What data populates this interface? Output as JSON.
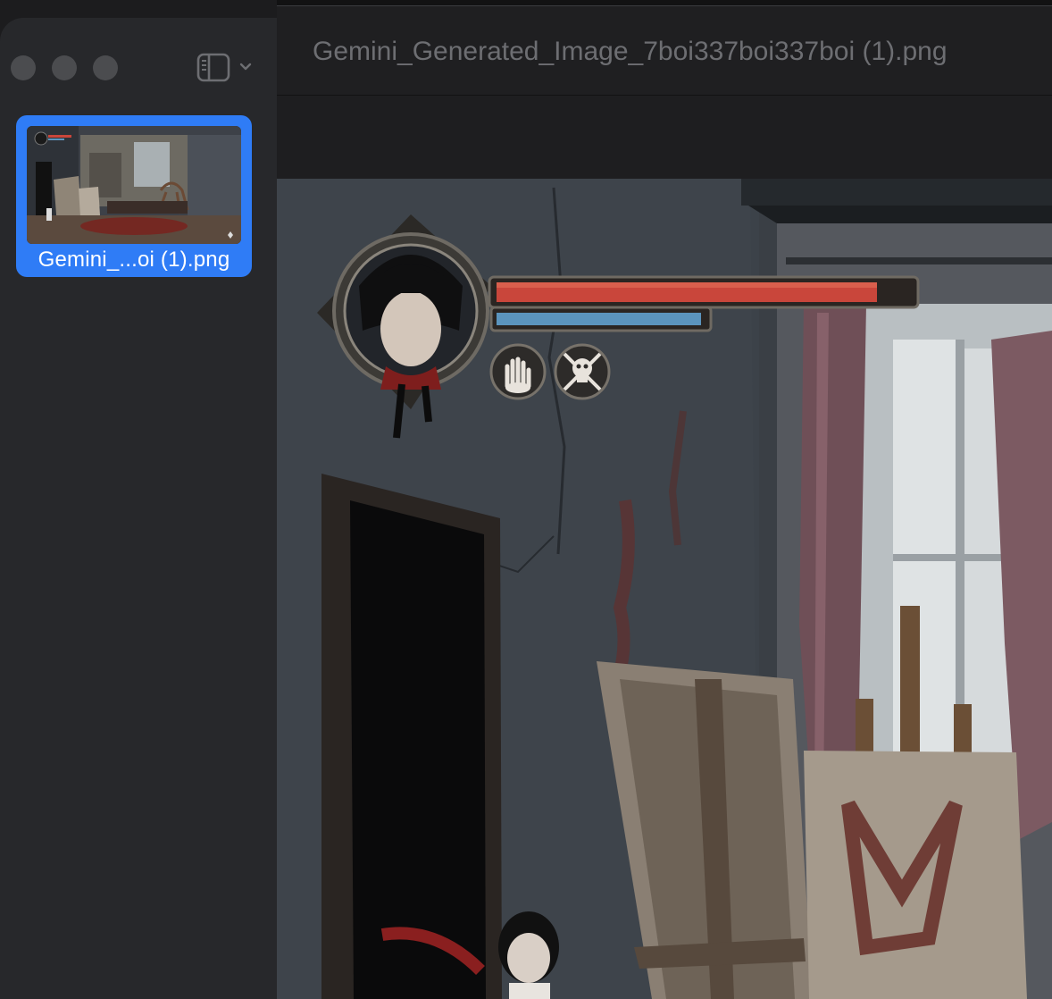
{
  "window": {
    "title": "Gemini_Generated_Image_7boi337boi337boi (1).png"
  },
  "sidebar": {
    "thumbnails": [
      {
        "label": "Gemini_...oi (1).png",
        "selected": true
      }
    ]
  },
  "game_hud": {
    "health_fraction": 0.93,
    "mana_fraction": 0.97,
    "health_color": "#c9463b",
    "mana_color": "#5b94bd",
    "ability_icons": [
      "hand-ability-icon",
      "skull-crossbones-ability-icon"
    ]
  },
  "colors": {
    "selection_accent": "#2f7cf6",
    "sidebar_bg": "#27282b",
    "window_bg": "#1e1e20"
  }
}
